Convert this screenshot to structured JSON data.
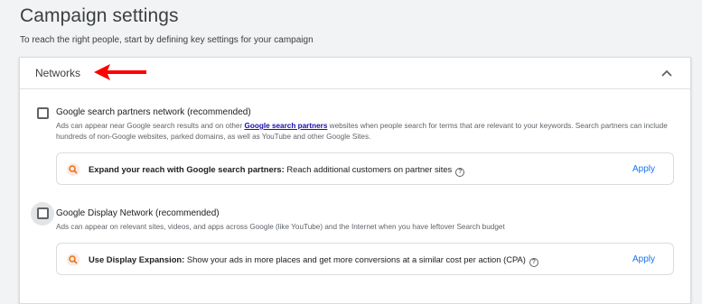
{
  "page": {
    "title": "Campaign settings",
    "subtitle": "To reach the right people, start by defining key settings for your campaign"
  },
  "networks": {
    "section_title": "Networks",
    "search_partners": {
      "label": "Google search partners network (recommended)",
      "desc_before": "Ads can appear near Google search results and on other ",
      "desc_link": "Google search partners",
      "desc_after": " websites when people search for terms that are relevant to your keywords. Search partners can include hundreds of non-Google websites, parked domains, as well as YouTube and other Google Sites.",
      "checked": false,
      "suggestion": {
        "bold": "Expand your reach with Google search partners:",
        "text": " Reach additional customers on partner sites",
        "help": "?",
        "apply": "Apply"
      }
    },
    "display": {
      "label": "Google Display Network (recommended)",
      "desc": "Ads can appear on relevant sites, videos, and apps across Google (like YouTube) and the Internet when you have leftover Search budget",
      "checked": false,
      "suggestion": {
        "bold": "Use Display Expansion:",
        "text": " Show your ads in more places and get more conversions at a similar cost per action (CPA)",
        "help": "?",
        "apply": "Apply"
      }
    }
  },
  "icons": {
    "collapse": "chevron-up-icon",
    "annotation": "red-arrow-icon",
    "suggestion": "search-icon",
    "help": "help-icon"
  },
  "colors": {
    "accent": "#1a73e8",
    "annotation": "#ff0000",
    "suggestion_icon": "#e8710a",
    "link": "#1a0dab"
  }
}
